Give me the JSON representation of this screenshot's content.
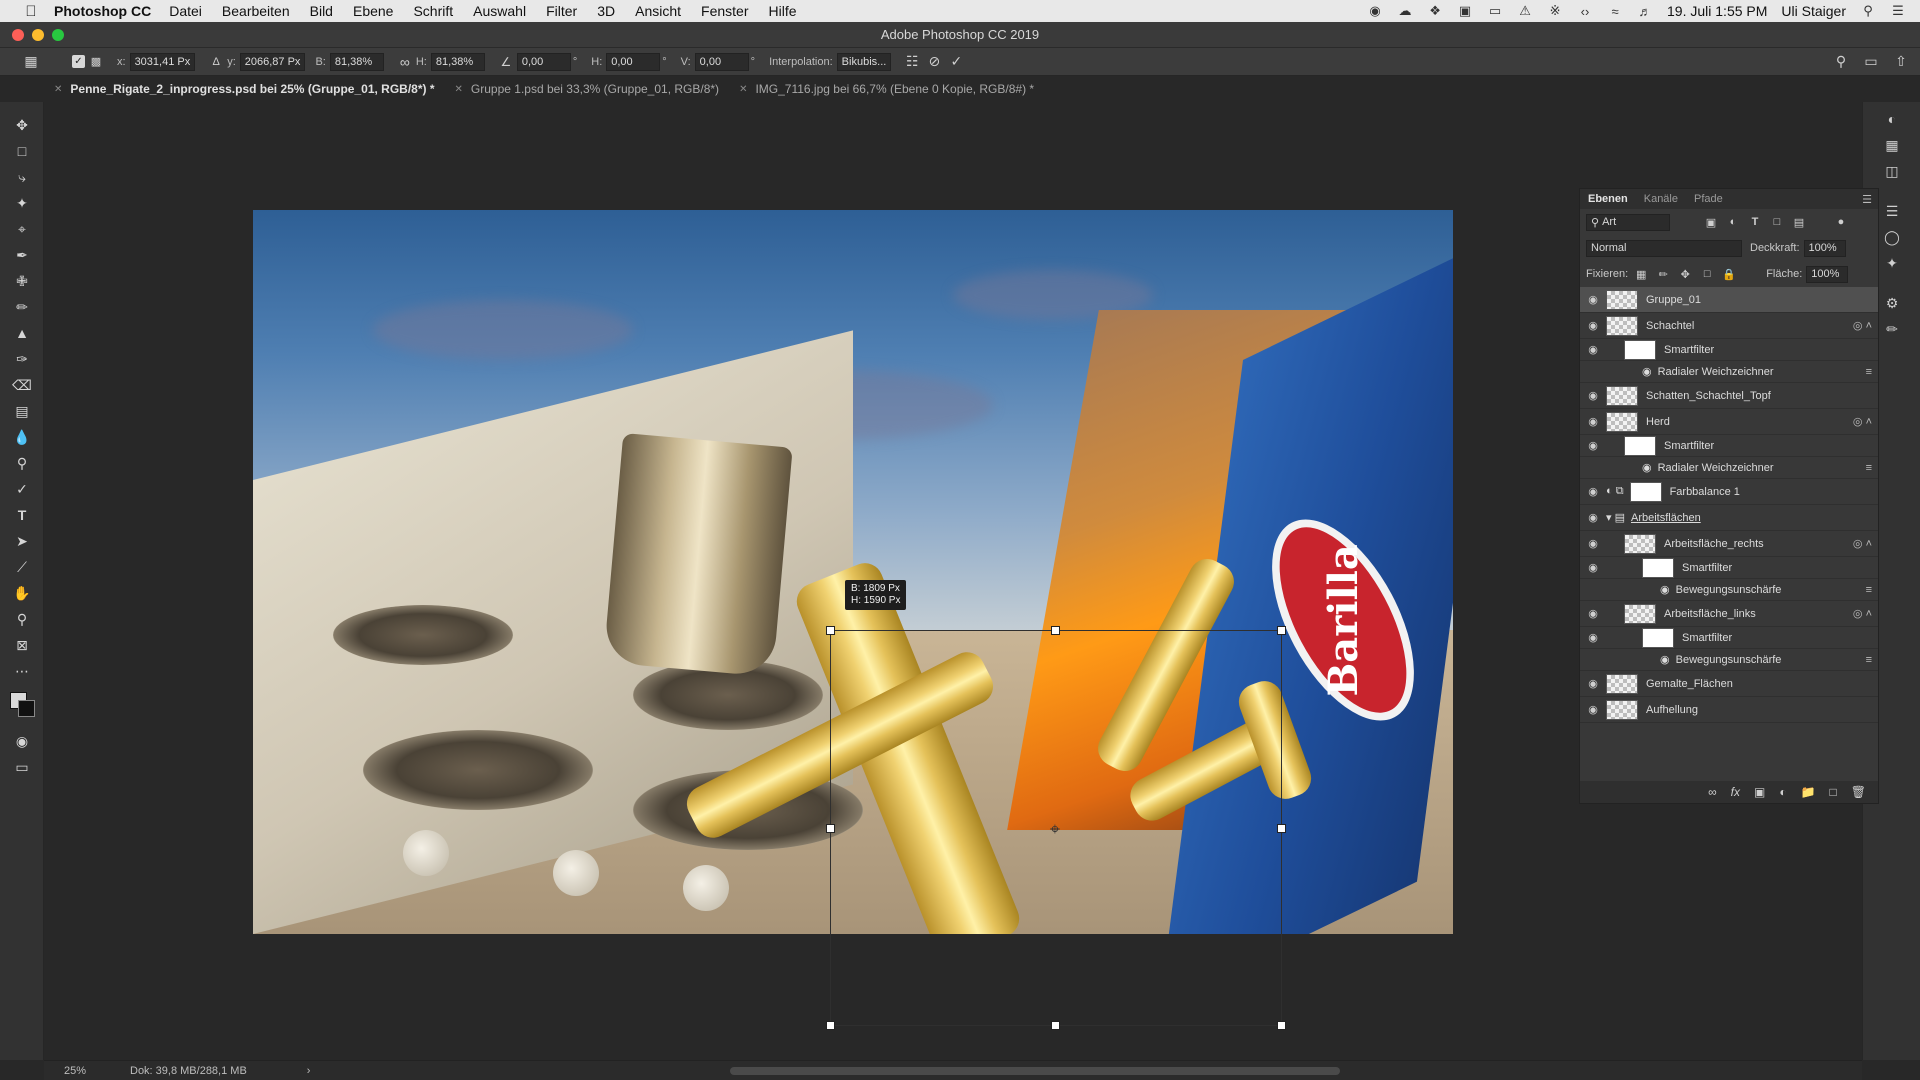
{
  "menubar": {
    "app_name": "Photoshop CC",
    "items": [
      "Datei",
      "Bearbeiten",
      "Bild",
      "Ebene",
      "Schrift",
      "Auswahl",
      "Filter",
      "3D",
      "Ansicht",
      "Fenster",
      "Hilfe"
    ],
    "clock": "19. Juli  1:55 PM",
    "user": "Uli Staiger"
  },
  "window": {
    "title": "Adobe Photoshop CC 2019"
  },
  "options_bar": {
    "x_label": "x:",
    "x_value": "3031,41 Px",
    "y_label": "y:",
    "y_value": "2066,87 Px",
    "w_label": "B:",
    "w_value": "81,38%",
    "h_label": "H:",
    "h_value": "81,38%",
    "angle_value": "0,00",
    "hskew_label": "H:",
    "hskew_value": "0,00",
    "vskew_label": "V:",
    "vskew_value": "0,00",
    "interpolation_label": "Interpolation:",
    "interpolation_value": "Bikubis..."
  },
  "tabs": [
    {
      "label": "Penne_Rigate_2_inprogress.psd bei 25% (Gruppe_01, RGB/8*) *",
      "active": true
    },
    {
      "label": "Gruppe 1.psd bei 33,3% (Gruppe_01, RGB/8*)",
      "active": false
    },
    {
      "label": "IMG_7116.jpg bei 66,7% (Ebene 0 Kopie, RGB/8#) *",
      "active": false
    }
  ],
  "transform_tooltip": {
    "w": "B: 1809 Px",
    "h": "H: 1590 Px"
  },
  "canvas": {
    "logo_text": "Barilla"
  },
  "layers_panel": {
    "tabs": [
      "Ebenen",
      "Kanäle",
      "Pfade"
    ],
    "filter_label": "Art",
    "blend_mode": "Normal",
    "opacity_label": "Deckkraft:",
    "opacity_value": "100%",
    "lock_label": "Fixieren:",
    "fill_label": "Fläche:",
    "fill_value": "100%",
    "layers": [
      {
        "name": "Gruppe_01",
        "selected": true,
        "indent": 0,
        "type": "layer"
      },
      {
        "name": "Schachtel",
        "selected": false,
        "indent": 0,
        "type": "smart"
      },
      {
        "name": "Smartfilter",
        "selected": false,
        "indent": 1,
        "type": "smartfilter"
      },
      {
        "name": "Radialer Weichzeichner",
        "selected": false,
        "indent": 2,
        "type": "filter"
      },
      {
        "name": "Schatten_Schachtel_Topf",
        "selected": false,
        "indent": 0,
        "type": "layer"
      },
      {
        "name": "Herd",
        "selected": false,
        "indent": 0,
        "type": "smart"
      },
      {
        "name": "Smartfilter",
        "selected": false,
        "indent": 1,
        "type": "smartfilter"
      },
      {
        "name": "Radialer Weichzeichner",
        "selected": false,
        "indent": 2,
        "type": "filter"
      },
      {
        "name": "Farbbalance 1",
        "selected": false,
        "indent": 0,
        "type": "adjustment"
      },
      {
        "name": "Arbeitsflächen",
        "selected": false,
        "indent": 0,
        "type": "group"
      },
      {
        "name": "Arbeitsfläche_rechts",
        "selected": false,
        "indent": 1,
        "type": "smart"
      },
      {
        "name": "Smartfilter",
        "selected": false,
        "indent": 2,
        "type": "smartfilter"
      },
      {
        "name": "Bewegungsunschärfe",
        "selected": false,
        "indent": 3,
        "type": "filter"
      },
      {
        "name": "Arbeitsfläche_links",
        "selected": false,
        "indent": 1,
        "type": "smart"
      },
      {
        "name": "Smartfilter",
        "selected": false,
        "indent": 2,
        "type": "smartfilter"
      },
      {
        "name": "Bewegungsunschärfe",
        "selected": false,
        "indent": 3,
        "type": "filter"
      },
      {
        "name": "Gemalte_Flächen",
        "selected": false,
        "indent": 0,
        "type": "layer"
      },
      {
        "name": "Aufhellung",
        "selected": false,
        "indent": 0,
        "type": "layer"
      }
    ]
  },
  "status_bar": {
    "zoom": "25%",
    "doc": "Dok: 39,8 MB/288,1 MB"
  },
  "colors": {
    "traffic_red": "#fc5f57",
    "traffic_yellow": "#fdbc2e",
    "traffic_green": "#28c840"
  }
}
